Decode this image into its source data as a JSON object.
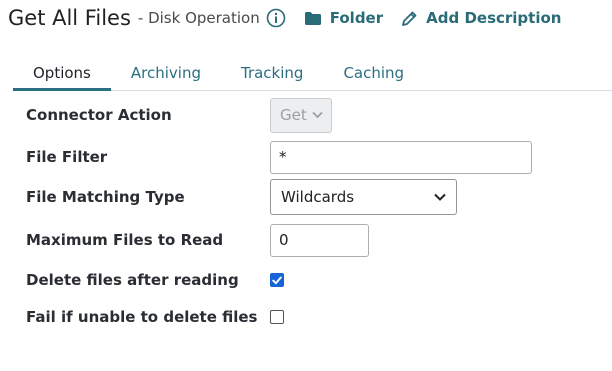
{
  "header": {
    "title": "Get All Files",
    "subtitle": "- Disk Operation",
    "folder_label": "Folder",
    "add_description_label": "Add Description"
  },
  "tabs": [
    {
      "label": "Options",
      "active": true
    },
    {
      "label": "Archiving",
      "active": false
    },
    {
      "label": "Tracking",
      "active": false
    },
    {
      "label": "Caching",
      "active": false
    }
  ],
  "form": {
    "connector_action": {
      "label": "Connector Action",
      "value": "Get",
      "disabled": true
    },
    "file_filter": {
      "label": "File Filter",
      "value": "*"
    },
    "file_matching_type": {
      "label": "File Matching Type",
      "value": "Wildcards"
    },
    "max_files": {
      "label": "Maximum Files to Read",
      "value": "0"
    },
    "delete_after_reading": {
      "label": "Delete files after reading",
      "checked": true
    },
    "fail_if_unable": {
      "label": "Fail if unable to delete files",
      "checked": false
    }
  },
  "colors": {
    "accent": "#2a6b78",
    "checkbox": "#1565d8"
  },
  "icons": {
    "info": "info-icon",
    "folder": "folder-icon",
    "pencil": "pencil-icon",
    "chevron": "chevron-down-icon",
    "check": "checkmark-icon"
  }
}
